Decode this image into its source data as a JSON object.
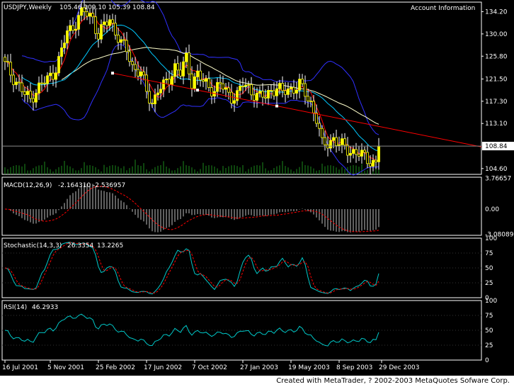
{
  "colors": {
    "background": "#000000",
    "grid": "#ffffff",
    "candle_up": "#ffff00",
    "candle_down": "#ffff00",
    "ma_fast": "#ff0000",
    "ma_mid": "#00c8ff",
    "ma_slow": "#ffffcc",
    "bands": "#3030ff",
    "trendline": "#ff0000",
    "volume": "#1b8a1b",
    "macd_hist": "#c0c0c0",
    "macd_signal": "#ff0000",
    "stoch_main": "#00c8c8",
    "stoch_signal": "#ff0000",
    "rsi": "#00c8c8",
    "price_label_bg": "#ffffff"
  },
  "footer_text": "Created with MetaTrader, ? 2002-2003 MetaQuotes Sofware Corp.",
  "chart_data": [
    {
      "type": "candlestick",
      "title": "USDJPY,Weekly",
      "ohlc_label": "105.46 109.10 105.39 108.84",
      "panel_label": "Account Information",
      "current_price": 108.84,
      "current_price_label": "108.84",
      "ylim": [
        103.5,
        136.0
      ],
      "y_ticks": [
        "134.20",
        "130.00",
        "125.80",
        "121.50",
        "117.30",
        "113.10",
        "104.60"
      ],
      "x_ticks": [
        "16 Jul 2001",
        "5 Nov 2001",
        "25 Feb 2002",
        "17 Jun 2002",
        "7 Oct 2002",
        "27 Jan 2003",
        "19 May 2003",
        "8 Sep 2003",
        "29 Dec 2003"
      ],
      "close_keypoints": [
        [
          0,
          124.2
        ],
        [
          4,
          121.0
        ],
        [
          7,
          118.5
        ],
        [
          9,
          117.6
        ],
        [
          11,
          119.5
        ],
        [
          14,
          120.9
        ],
        [
          17,
          122.5
        ],
        [
          20,
          126.5
        ],
        [
          22,
          130.5
        ],
        [
          24,
          131.2
        ],
        [
          26,
          133.4
        ],
        [
          28,
          134.0
        ],
        [
          31,
          133.2
        ],
        [
          33,
          129.5
        ],
        [
          35,
          131.5
        ],
        [
          37,
          132.8
        ],
        [
          39,
          130.6
        ],
        [
          41,
          128.0
        ],
        [
          43,
          127.0
        ],
        [
          45,
          124.0
        ],
        [
          48,
          122.5
        ],
        [
          50,
          119.0
        ],
        [
          52,
          117.0
        ],
        [
          54,
          119.5
        ],
        [
          56,
          120.0
        ],
        [
          58,
          121.5
        ],
        [
          60,
          124.0
        ],
        [
          62,
          122.5
        ],
        [
          64,
          125.3
        ],
        [
          66,
          121.0
        ],
        [
          68,
          122.5
        ],
        [
          70,
          120.8
        ],
        [
          72,
          120.0
        ],
        [
          74,
          119.5
        ],
        [
          76,
          120.5
        ],
        [
          78,
          119.0
        ],
        [
          80,
          118.2
        ],
        [
          82,
          118.5
        ],
        [
          84,
          120.4
        ],
        [
          86,
          119.8
        ],
        [
          88,
          118.8
        ],
        [
          90,
          118.0
        ],
        [
          92,
          118.2
        ],
        [
          94,
          119.5
        ],
        [
          96,
          119.8
        ],
        [
          98,
          118.8
        ],
        [
          100,
          119.6
        ],
        [
          102,
          119.8
        ],
        [
          104,
          120.3
        ],
        [
          106,
          118.8
        ],
        [
          108,
          117.0
        ],
        [
          110,
          114.0
        ],
        [
          111,
          111.5
        ],
        [
          112,
          109.0
        ],
        [
          114,
          109.5
        ],
        [
          116,
          110.3
        ],
        [
          118,
          109.0
        ],
        [
          120,
          108.6
        ],
        [
          122,
          108.0
        ],
        [
          124,
          107.5
        ],
        [
          126,
          107.0
        ],
        [
          128,
          106.5
        ],
        [
          130,
          105.8
        ],
        [
          131,
          105.5
        ],
        [
          132,
          108.84
        ]
      ],
      "volume_max_index": 46,
      "trendline": {
        "from": [
          38,
          122.6
        ],
        "to": [
          96,
          116.4
        ]
      },
      "macd": {
        "label": "MACD(12,26,9)",
        "main": "-2.164310",
        "signal": "-2.536957",
        "ticks": [
          "3.76657",
          "0.00",
          "-3.08089"
        ],
        "ylim": [
          -3.2,
          3.9
        ]
      },
      "stochastic": {
        "label": "Stochastic(14,3,3)",
        "main": "26.3354",
        "signal": "13.2265",
        "ticks": [
          "100",
          "75",
          "50",
          "25",
          "0"
        ],
        "ylim": [
          0,
          100
        ]
      },
      "rsi": {
        "label": "RSI(14)",
        "value": "46.2933",
        "ticks": [
          "100",
          "75",
          "50",
          "25",
          "0"
        ],
        "ylim": [
          0,
          100
        ]
      }
    }
  ]
}
